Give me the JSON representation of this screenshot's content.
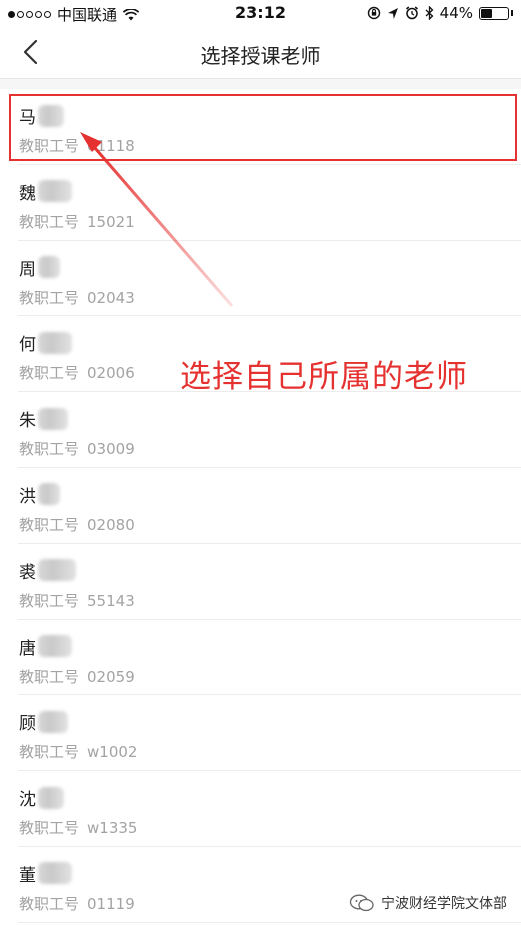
{
  "status_bar": {
    "carrier": "中国联通",
    "time": "23:12",
    "battery_text": "44%",
    "battery_level": 0.44,
    "signal_bars_filled": 1,
    "signal_bars_total": 5
  },
  "nav": {
    "title": "选择授课老师",
    "back_icon": "chevron-left-icon"
  },
  "teachers": [
    {
      "surname": "马",
      "id_label": "教职工号",
      "id": "01118",
      "selected": true
    },
    {
      "surname": "魏",
      "id_label": "教职工号",
      "id": "15021"
    },
    {
      "surname": "周",
      "id_label": "教职工号",
      "id": "02043"
    },
    {
      "surname": "何",
      "id_label": "教职工号",
      "id": "02006"
    },
    {
      "surname": "朱",
      "id_label": "教职工号",
      "id": "03009"
    },
    {
      "surname": "洪",
      "id_label": "教职工号",
      "id": "02080"
    },
    {
      "surname": "裘",
      "id_label": "教职工号",
      "id": "55143"
    },
    {
      "surname": "唐",
      "id_label": "教职工号",
      "id": "02059"
    },
    {
      "surname": "顾",
      "id_label": "教职工号",
      "id": "w1002"
    },
    {
      "surname": "沈",
      "id_label": "教职工号",
      "id": "w1335"
    },
    {
      "surname": "董",
      "id_label": "教职工号",
      "id": "01119"
    }
  ],
  "annotation": {
    "text": "选择自己所属的老师",
    "color": "#e5312f"
  },
  "watermark": {
    "text": "宁波财经学院文体部"
  },
  "colors": {
    "accent_red": "#e5312f",
    "secondary_text": "#a3a3a3"
  }
}
